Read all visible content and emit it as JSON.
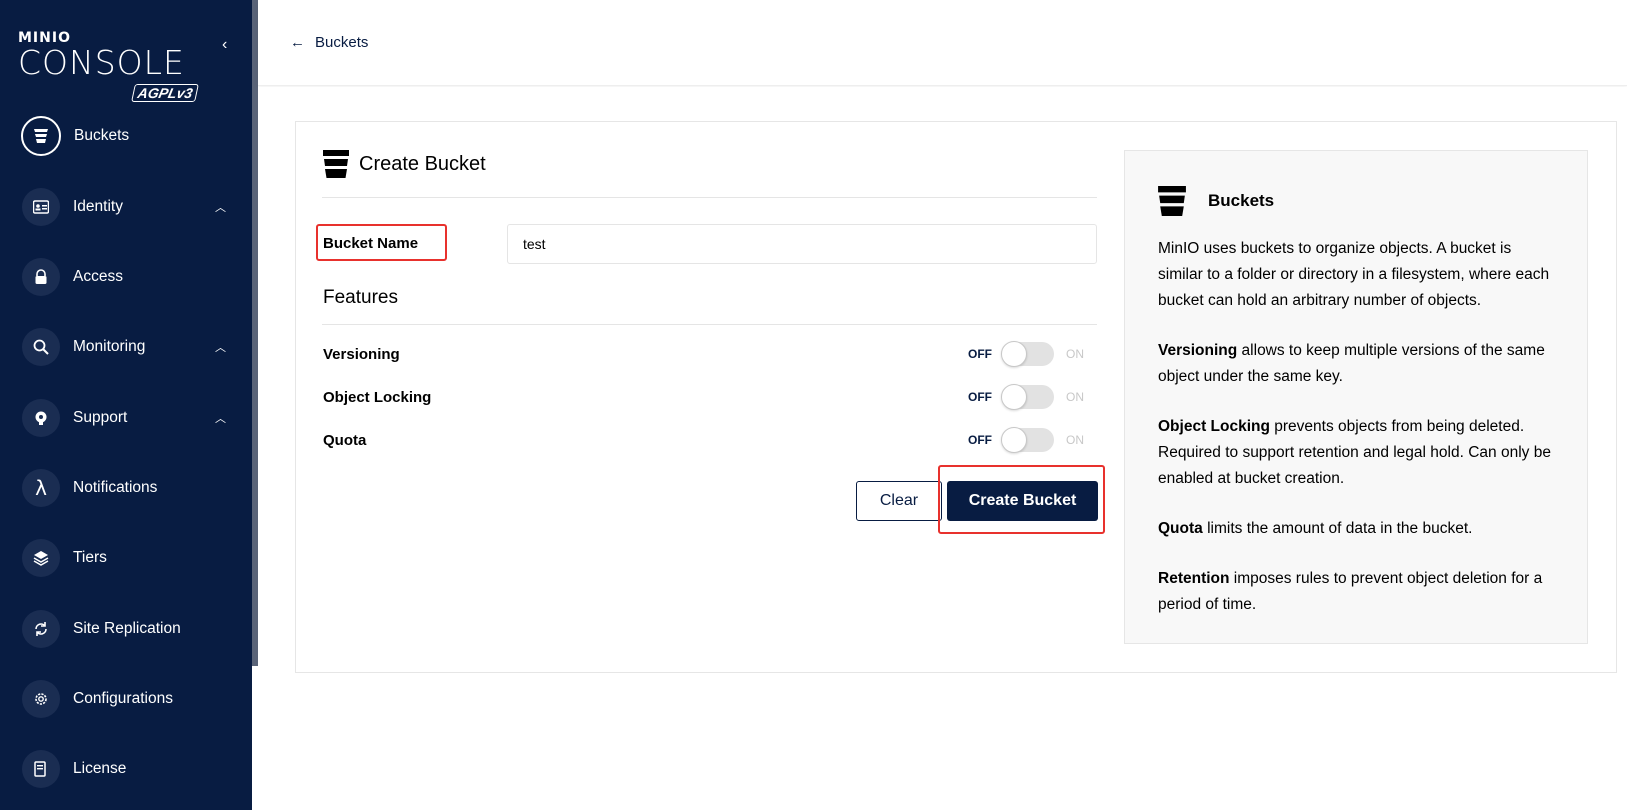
{
  "sidebar": {
    "logo": {
      "small": "MINIO",
      "big": "CONSOLE",
      "license": "AGPLv3"
    },
    "items": [
      {
        "label": "Buckets",
        "icon": "bucket-icon",
        "active": true,
        "chevron": ""
      },
      {
        "label": "Identity",
        "icon": "id-card-icon",
        "active": false,
        "chevron": "^"
      },
      {
        "label": "Access",
        "icon": "lock-icon",
        "active": false,
        "chevron": ""
      },
      {
        "label": "Monitoring",
        "icon": "magnifier-icon",
        "active": false,
        "chevron": "^"
      },
      {
        "label": "Support",
        "icon": "support-icon",
        "active": false,
        "chevron": "^"
      },
      {
        "label": "Notifications",
        "icon": "lambda-icon",
        "active": false,
        "chevron": ""
      },
      {
        "label": "Tiers",
        "icon": "layers-icon",
        "active": false,
        "chevron": ""
      },
      {
        "label": "Site Replication",
        "icon": "replication-icon",
        "active": false,
        "chevron": ""
      },
      {
        "label": "Configurations",
        "icon": "gear-icon",
        "active": false,
        "chevron": ""
      },
      {
        "label": "License",
        "icon": "license-icon",
        "active": false,
        "chevron": ""
      }
    ]
  },
  "topbar": {
    "back_label": "Buckets"
  },
  "form": {
    "title": "Create Bucket",
    "bucket_name_label": "Bucket Name",
    "bucket_name_value": "test",
    "features_title": "Features",
    "features": [
      {
        "label": "Versioning",
        "off": "OFF",
        "on": "ON",
        "enabled": false
      },
      {
        "label": "Object Locking",
        "off": "OFF",
        "on": "ON",
        "enabled": false
      },
      {
        "label": "Quota",
        "off": "OFF",
        "on": "ON",
        "enabled": false
      }
    ],
    "clear_label": "Clear",
    "create_label": "Create Bucket"
  },
  "help": {
    "title": "Buckets",
    "intro": "MinIO uses buckets to organize objects. A bucket is similar to a folder or directory in a filesystem, where each bucket can hold an arbitrary number of objects.",
    "versioning_term": "Versioning",
    "versioning_text": " allows to keep multiple versions of the same object under the same key.",
    "locking_term": "Object Locking",
    "locking_text": " prevents objects from being deleted. Required to support retention and legal hold. Can only be enabled at bucket creation.",
    "quota_term": "Quota",
    "quota_text": " limits the amount of data in the bucket.",
    "retention_term": "Retention",
    "retention_text": " imposes rules to prevent object deletion for a period of time."
  },
  "colors": {
    "navy": "#081C42",
    "highlight": "#e8312d",
    "panel": "#f8f8f8"
  }
}
